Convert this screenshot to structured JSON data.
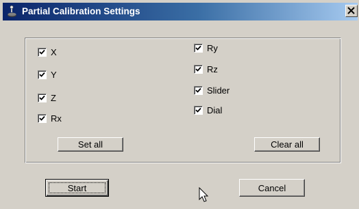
{
  "window": {
    "title": "Partial Calibration Settings",
    "close_glyph": "✕"
  },
  "axes_left": [
    {
      "label": "X",
      "checked": true
    },
    {
      "label": "Y",
      "checked": true
    },
    {
      "label": "Z",
      "checked": true
    },
    {
      "label": "Rx",
      "checked": true
    }
  ],
  "axes_right": [
    {
      "label": "Ry",
      "checked": true
    },
    {
      "label": "Rz",
      "checked": true
    },
    {
      "label": "Slider",
      "checked": true
    },
    {
      "label": "Dial",
      "checked": true
    }
  ],
  "buttons": {
    "set_all": "Set all",
    "clear_all": "Clear all",
    "start": "Start",
    "cancel": "Cancel"
  },
  "icons": {
    "title": "joystick-icon",
    "close": "close-icon",
    "checkmark": "checkmark-icon",
    "cursor": "mouse-pointer-icon"
  },
  "colors": {
    "face": "#d4d0c8",
    "title_start": "#0a246a",
    "title_end": "#a6caf0"
  }
}
